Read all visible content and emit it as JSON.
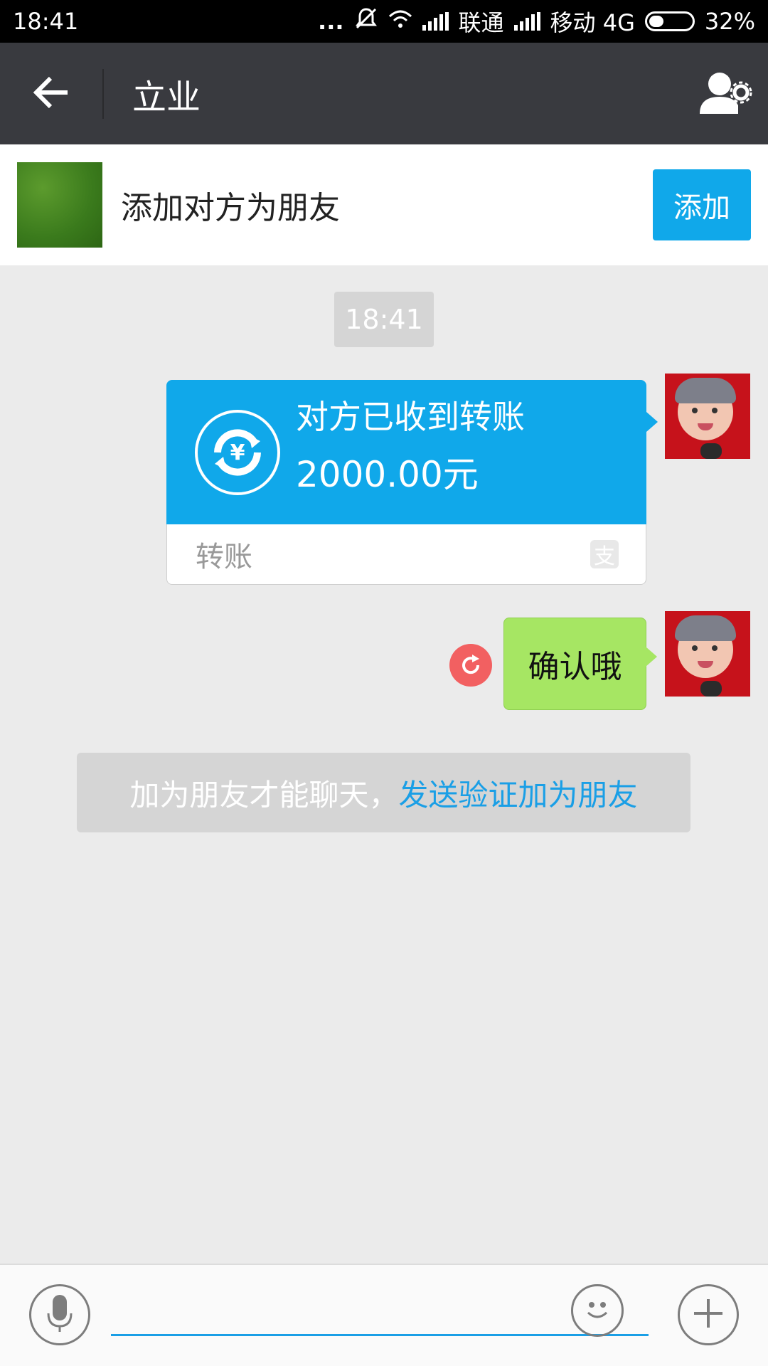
{
  "status_bar": {
    "time": "18:41",
    "dots": "...",
    "carrier1": "联通",
    "carrier2": "移动 4G",
    "battery": "32%"
  },
  "header": {
    "title": "立业",
    "back_icon": "arrow-left-icon",
    "profile_icon": "user-settings-icon"
  },
  "add_friend_banner": {
    "text": "添加对方为朋友",
    "button_label": "添加"
  },
  "chat": {
    "timestamp": "18:41",
    "transfer": {
      "status": "对方已收到转账",
      "amount": "2000.00元",
      "label": "转账",
      "icon": "yuan-transfer-icon",
      "brand_icon": "alipay-icon"
    },
    "message": {
      "text": "确认哦",
      "resend_icon": "resend-icon"
    },
    "notice": {
      "prefix": "加为朋友才能聊天，",
      "link": "发送验证加为朋友"
    }
  },
  "input_bar": {
    "voice_icon": "microphone-icon",
    "emoji_icon": "smiley-icon",
    "plus_icon": "plus-icon",
    "placeholder": ""
  },
  "colors": {
    "accent": "#10a8ea",
    "bubble_green": "#a6e663",
    "header_bg": "#393a3f",
    "chat_bg": "#ebebeb",
    "error_red": "#f26061"
  }
}
